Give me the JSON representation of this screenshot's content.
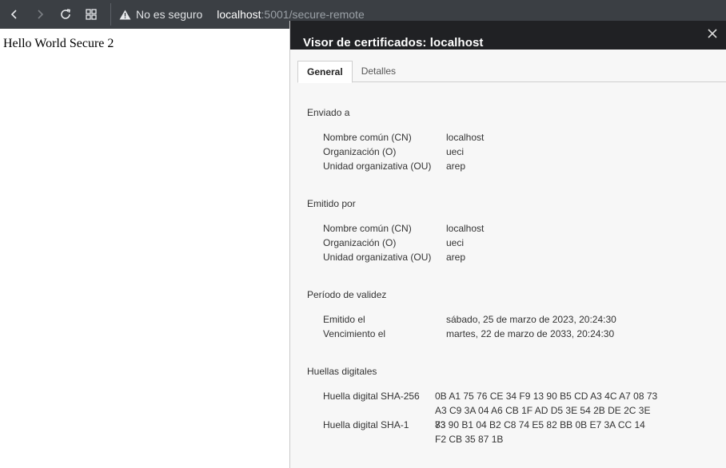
{
  "browser": {
    "security_label": "No es seguro",
    "url_host": "localhost",
    "url_rest": ":5001/secure-remote"
  },
  "page": {
    "text": "Hello World Secure 2"
  },
  "cert": {
    "title": "Visor de certificados: localhost",
    "tabs": [
      {
        "label": "General"
      },
      {
        "label": "Detalles"
      }
    ],
    "issued_to": {
      "title": "Enviado a",
      "rows": [
        {
          "label": "Nombre común (CN)",
          "value": "localhost"
        },
        {
          "label": "Organización (O)",
          "value": "ueci"
        },
        {
          "label": "Unidad organizativa (OU)",
          "value": "arep"
        }
      ]
    },
    "issued_by": {
      "title": "Emitido por",
      "rows": [
        {
          "label": "Nombre común (CN)",
          "value": "localhost"
        },
        {
          "label": "Organización (O)",
          "value": "ueci"
        },
        {
          "label": "Unidad organizativa (OU)",
          "value": "arep"
        }
      ]
    },
    "validity": {
      "title": "Período de validez",
      "rows": [
        {
          "label": "Emitido el",
          "value": "sábado, 25 de marzo de 2023, 20:24:30"
        },
        {
          "label": "Vencimiento el",
          "value": "martes, 22 de marzo de 2033, 20:24:30"
        }
      ]
    },
    "fingerprints": {
      "title": "Huellas digitales",
      "rows": [
        {
          "label": "Huella digital SHA-256",
          "value": "0B A1 75 76 CE 34 F9 13 90 B5 CD A3 4C A7 08 73 A3 C9 3A 04 A6 CB 1F AD D5 3E 54 2B DE 2C 3E 83"
        },
        {
          "label": "Huella digital SHA-1",
          "value": "73 90 B1 04 B2 C8 74 E5 82 BB 0B E7 3A CC 14 F2 CB 35 87 1B"
        }
      ]
    }
  }
}
